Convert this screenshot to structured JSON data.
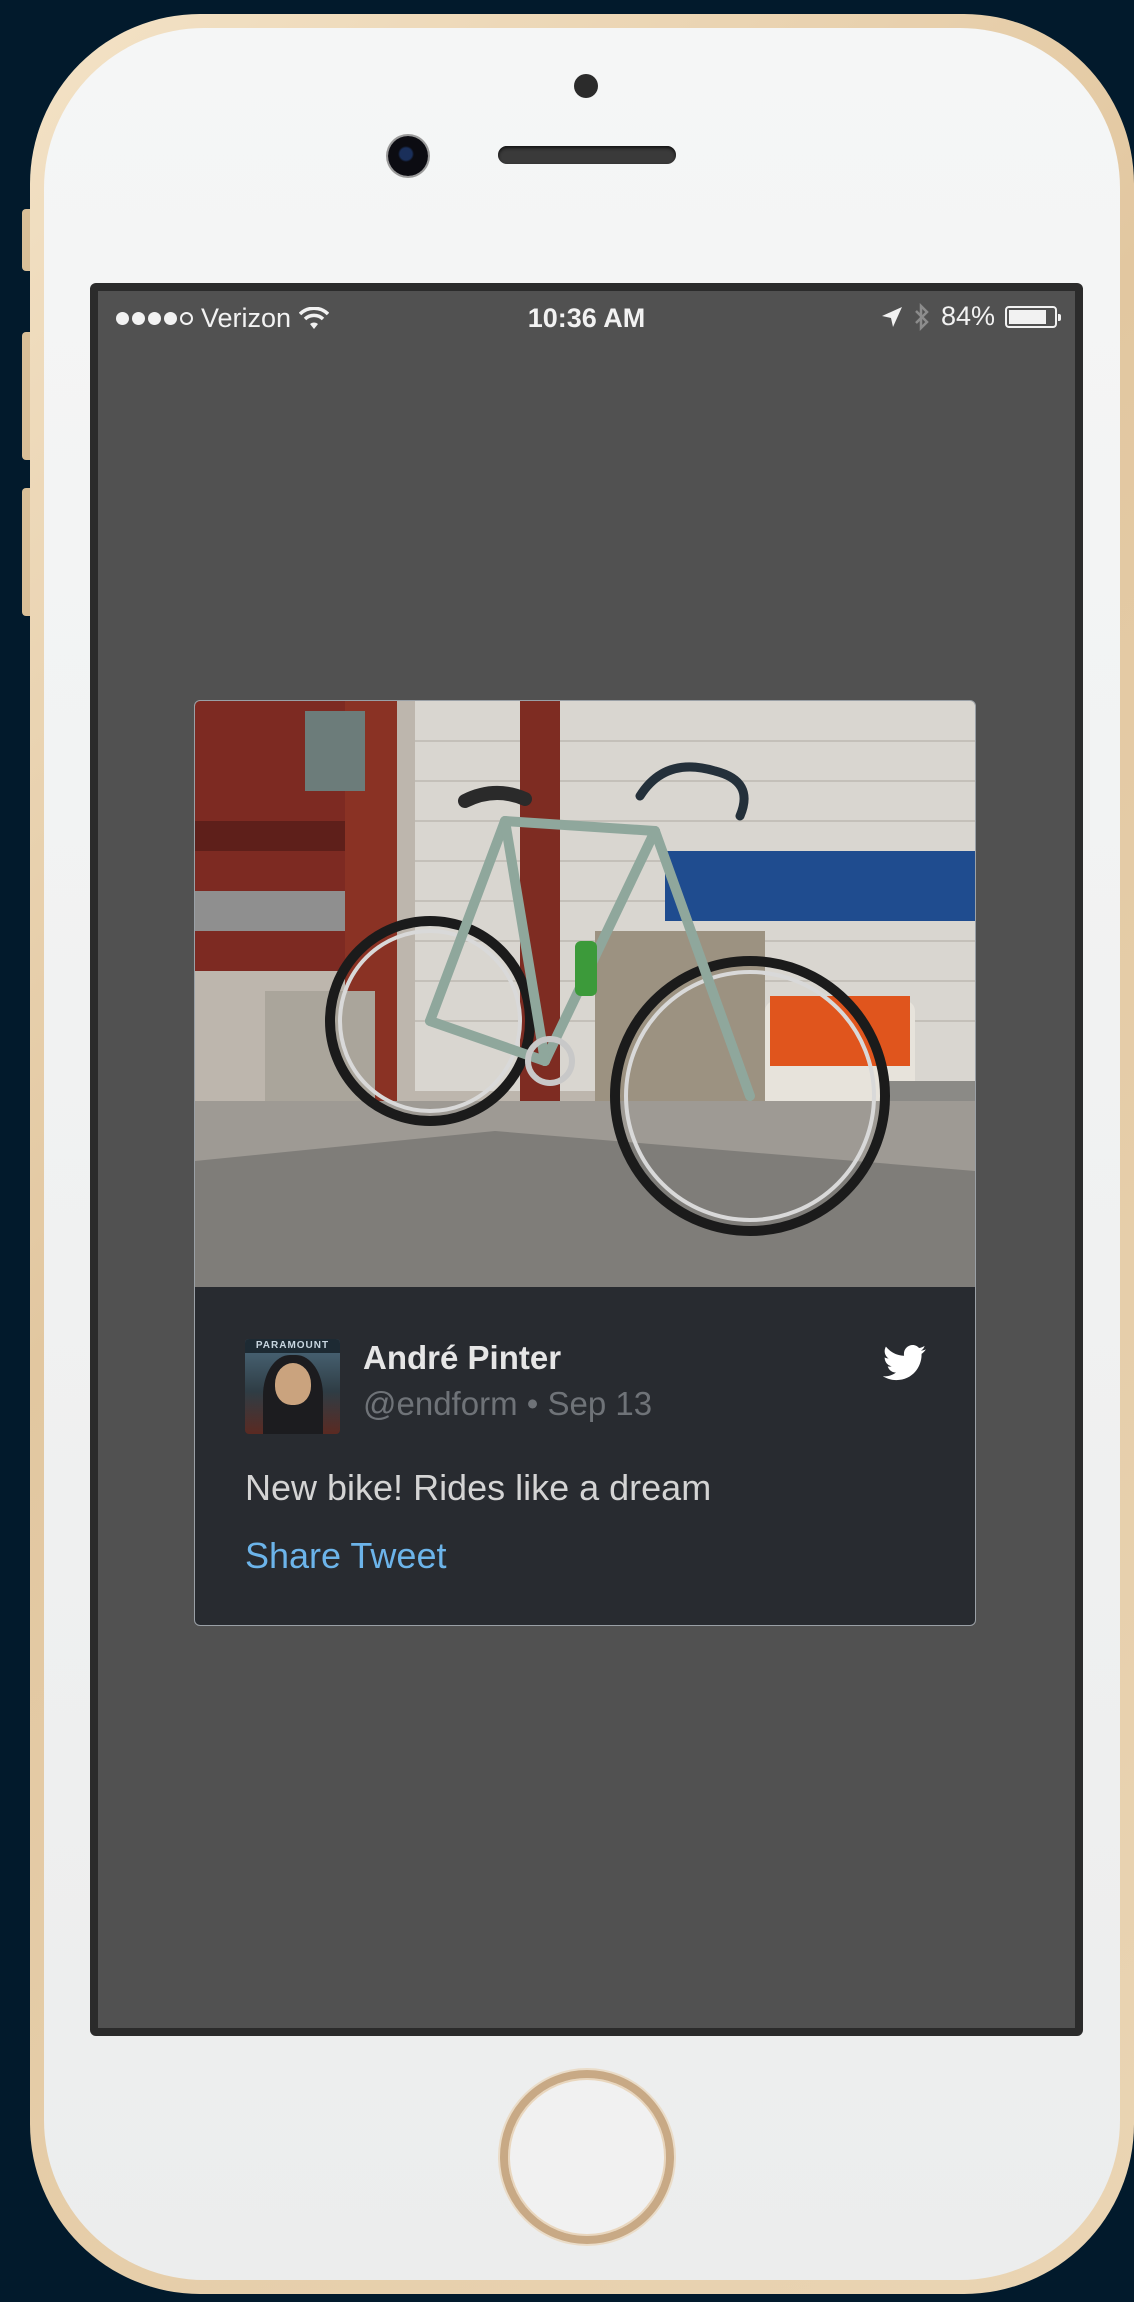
{
  "status_bar": {
    "carrier": "Verizon",
    "time": "10:36 AM",
    "battery": "84%",
    "battery_level": 0.84
  },
  "tweet": {
    "author_name": "André Pinter",
    "author_handle": "@endform",
    "date": "Sep 13",
    "meta_separator": " • ",
    "text": "New bike! Rides like a dream",
    "share_label": "Share Tweet",
    "avatar_banner": "PARAMOUNT"
  },
  "icons": {
    "carrier_signal": "signal-dots-icon",
    "wifi": "wifi-icon",
    "location": "location-arrow-icon",
    "bluetooth": "bluetooth-icon",
    "battery": "battery-icon",
    "twitter": "twitter-bird-icon"
  },
  "colors": {
    "screen_background": "#515151",
    "card_background": "#282b30",
    "link": "#6cb4ea"
  }
}
